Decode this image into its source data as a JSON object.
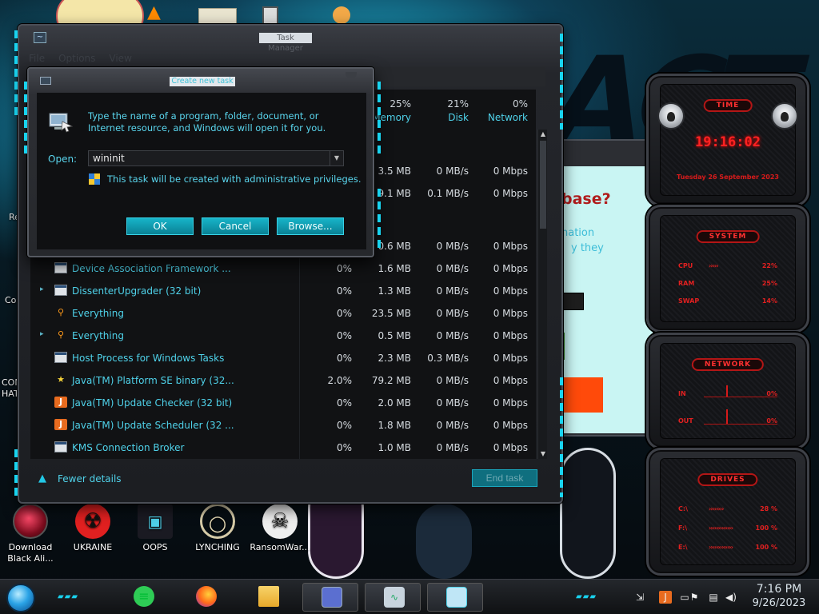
{
  "colors": {
    "accent_cyan": "#4fd2ea",
    "button_teal": "#0a8194",
    "gadget_red": "#ff2222",
    "dark_panel": "#111214"
  },
  "desktop": {
    "icons": [
      {
        "label": "Download Black Ali...",
        "icon": "alienware-orb-icon"
      },
      {
        "label": "UKRAINE",
        "icon": "radiation-icon"
      },
      {
        "label": "OOPS",
        "icon": "computer-icon"
      },
      {
        "label": "LYNCHING",
        "icon": "noose-icon"
      },
      {
        "label": "RansomWar...",
        "icon": "skull-icon"
      }
    ],
    "partial_labels": [
      "Re",
      "Co",
      "CON",
      "HAT"
    ]
  },
  "task_manager": {
    "title": "Task Manager",
    "menu": [
      "File",
      "Options",
      "View"
    ],
    "columns": [
      {
        "pct": "25%",
        "name": "Memory"
      },
      {
        "pct": "21%",
        "name": "Disk"
      },
      {
        "pct": "0%",
        "name": "Network"
      }
    ],
    "partial_rows": [
      {
        "mem": "3.5 MB",
        "disk": "0 MB/s",
        "net": "0 Mbps"
      },
      {
        "mem": "9.1 MB",
        "disk": "0.1 MB/s",
        "net": "0 Mbps"
      },
      {
        "mem": "0.6 MB",
        "disk": "0 MB/s",
        "net": "0 Mbps"
      }
    ],
    "processes": [
      {
        "name": "Device Association Framework ...",
        "expand": "",
        "icon": "window-icon",
        "cpu": "0%",
        "mem": "1.6 MB",
        "disk": "0 MB/s",
        "net": "0 Mbps"
      },
      {
        "name": "DissenterUpgrader (32 bit)",
        "expand": "▸",
        "icon": "window-icon",
        "cpu": "0%",
        "mem": "1.3 MB",
        "disk": "0 MB/s",
        "net": "0 Mbps"
      },
      {
        "name": "Everything",
        "expand": "",
        "icon": "search-icon",
        "cpu": "0%",
        "mem": "23.5 MB",
        "disk": "0 MB/s",
        "net": "0 Mbps"
      },
      {
        "name": "Everything",
        "expand": "▸",
        "icon": "search-icon",
        "cpu": "0%",
        "mem": "0.5 MB",
        "disk": "0 MB/s",
        "net": "0 Mbps"
      },
      {
        "name": "Host Process for Windows Tasks",
        "expand": "",
        "icon": "window-icon",
        "cpu": "0%",
        "mem": "2.3 MB",
        "disk": "0.3 MB/s",
        "net": "0 Mbps"
      },
      {
        "name": "Java(TM) Platform SE binary (32...",
        "expand": "",
        "icon": "star-icon",
        "cpu": "2.0%",
        "mem": "79.2 MB",
        "disk": "0 MB/s",
        "net": "0 Mbps"
      },
      {
        "name": "Java(TM) Update Checker (32 bit)",
        "expand": "",
        "icon": "java-icon",
        "cpu": "0%",
        "mem": "2.0 MB",
        "disk": "0 MB/s",
        "net": "0 Mbps"
      },
      {
        "name": "Java(TM) Update Scheduler (32 ...",
        "expand": "",
        "icon": "java-icon",
        "cpu": "0%",
        "mem": "1.8 MB",
        "disk": "0 MB/s",
        "net": "0 Mbps"
      },
      {
        "name": "KMS Connection Broker",
        "expand": "",
        "icon": "window-icon",
        "cpu": "0%",
        "mem": "1.0 MB",
        "disk": "0 MB/s",
        "net": "0 Mbps"
      }
    ],
    "fewer_details": "Fewer details",
    "end_task": "End task"
  },
  "dialog": {
    "title": "Create new task",
    "description": "Type the name of a program, folder, document, or Internet resource, and Windows will open it for you.",
    "open_label": "Open:",
    "open_value": "wininit",
    "admin_note": "This task will be created with administrative privileges.",
    "ok": "OK",
    "cancel": "Cancel",
    "browse": "Browse..."
  },
  "background_window": {
    "heading": "base?",
    "line1": "nation",
    "line2": "y they"
  },
  "gadget": {
    "time_title": "TIME",
    "time": "19:16:02",
    "date": "Tuesday 26 September 2023",
    "system_title": "SYSTEM",
    "system_rows": [
      {
        "label": "CPU",
        "bar": "›››››",
        "value": "22%"
      },
      {
        "label": "RAM",
        "bar": "",
        "value": "25%"
      },
      {
        "label": "SWAP",
        "bar": "",
        "value": "14%"
      }
    ],
    "network_title": "NETWORK",
    "network_rows": [
      {
        "label": "IN",
        "value": "0%"
      },
      {
        "label": "OUT",
        "value": "0%"
      }
    ],
    "drives_title": "DRIVES",
    "drive_rows": [
      {
        "label": "C:\\",
        "bar": "››››››››",
        "value": "28 %"
      },
      {
        "label": "F:\\",
        "bar": "›››››››››››››",
        "value": "100 %"
      },
      {
        "label": "E:\\",
        "bar": "›››››››››››››",
        "value": "100 %"
      }
    ]
  },
  "taskbar": {
    "pinned": [
      {
        "name": "notes-app",
        "icon": "notes-icon"
      },
      {
        "name": "firefox",
        "icon": "firefox-icon"
      },
      {
        "name": "file-explorer",
        "icon": "folder-icon"
      },
      {
        "name": "control-panel",
        "icon": "window-icon"
      },
      {
        "name": "task-manager",
        "icon": "chart-icon"
      },
      {
        "name": "run-dialog",
        "icon": "run-icon"
      }
    ],
    "clock_time": "7:16 PM",
    "clock_date": "9/26/2023"
  }
}
